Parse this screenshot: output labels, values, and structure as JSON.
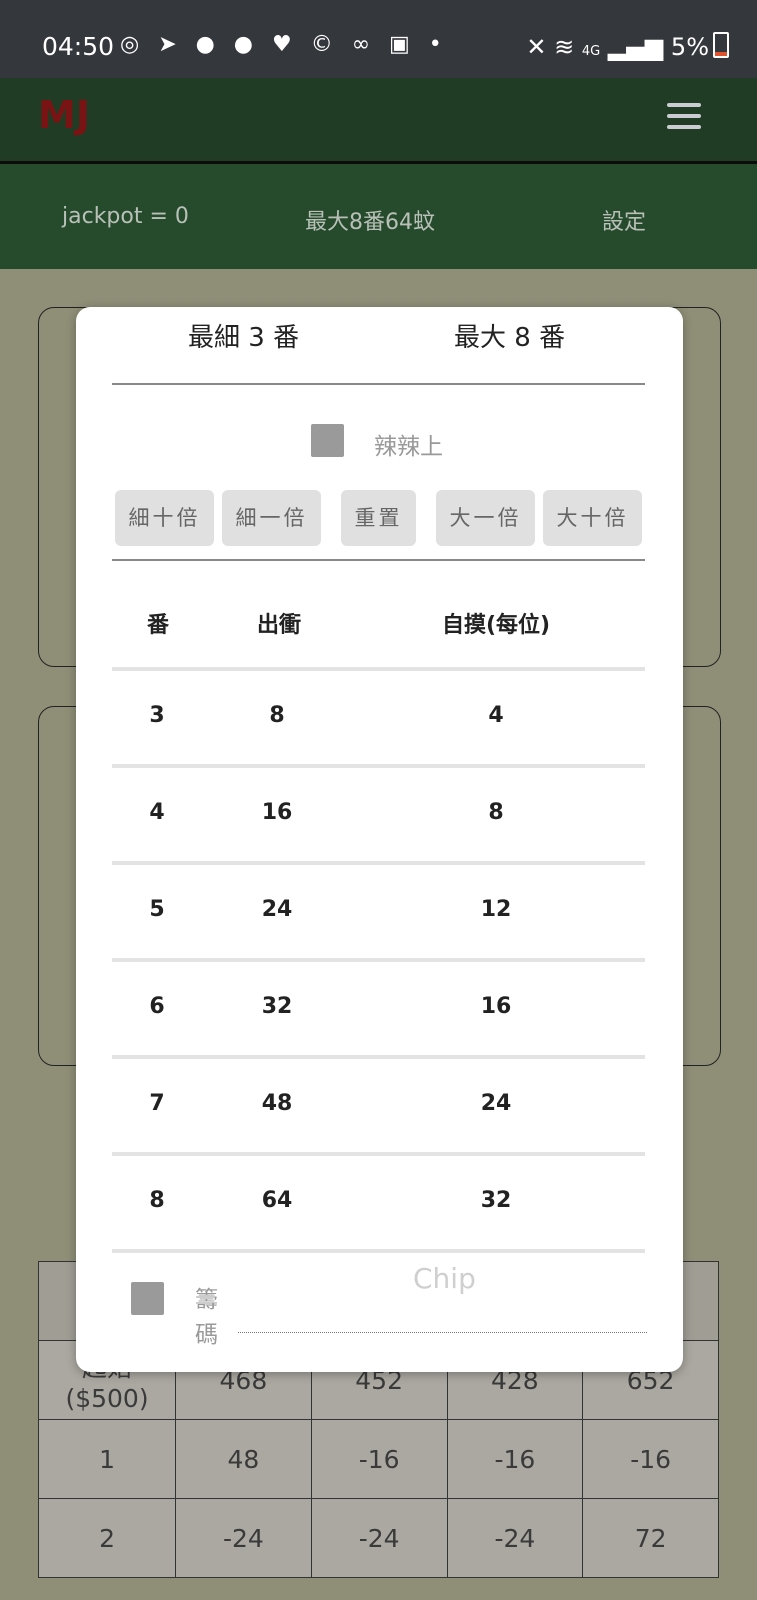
{
  "status_bar": {
    "time": "04:50",
    "battery": "5%",
    "network": "4G"
  },
  "app": {
    "logo": "MJ"
  },
  "info_bar": {
    "jackpot": "jackpot = 0",
    "max_rule": "最大8番64蚊",
    "settings": "設定"
  },
  "modal": {
    "min_label": "最細 3 番",
    "max_label": "最大 8 番",
    "spicy_label": "辣辣上",
    "buttons": [
      "細十倍",
      "細一倍",
      "重置",
      "大一倍",
      "大十倍"
    ],
    "table": {
      "headers": [
        "番",
        "出衝",
        "自摸(每位)"
      ],
      "rows": [
        [
          "3",
          "8",
          "4"
        ],
        [
          "4",
          "16",
          "8"
        ],
        [
          "5",
          "24",
          "12"
        ],
        [
          "6",
          "32",
          "16"
        ],
        [
          "7",
          "48",
          "24"
        ],
        [
          "8",
          "64",
          "32"
        ]
      ]
    },
    "chip_label_1": "籌",
    "chip_label_2": "碼",
    "chip_placeholder": "Chip"
  },
  "background_table": {
    "rows": [
      [
        "",
        "",
        "",
        "",
        ""
      ],
      [
        "起始 ($500)",
        "468",
        "452",
        "428",
        "652"
      ],
      [
        "1",
        "48",
        "-16",
        "-16",
        "-16"
      ],
      [
        "2",
        "-24",
        "-24",
        "-24",
        "72"
      ]
    ]
  }
}
